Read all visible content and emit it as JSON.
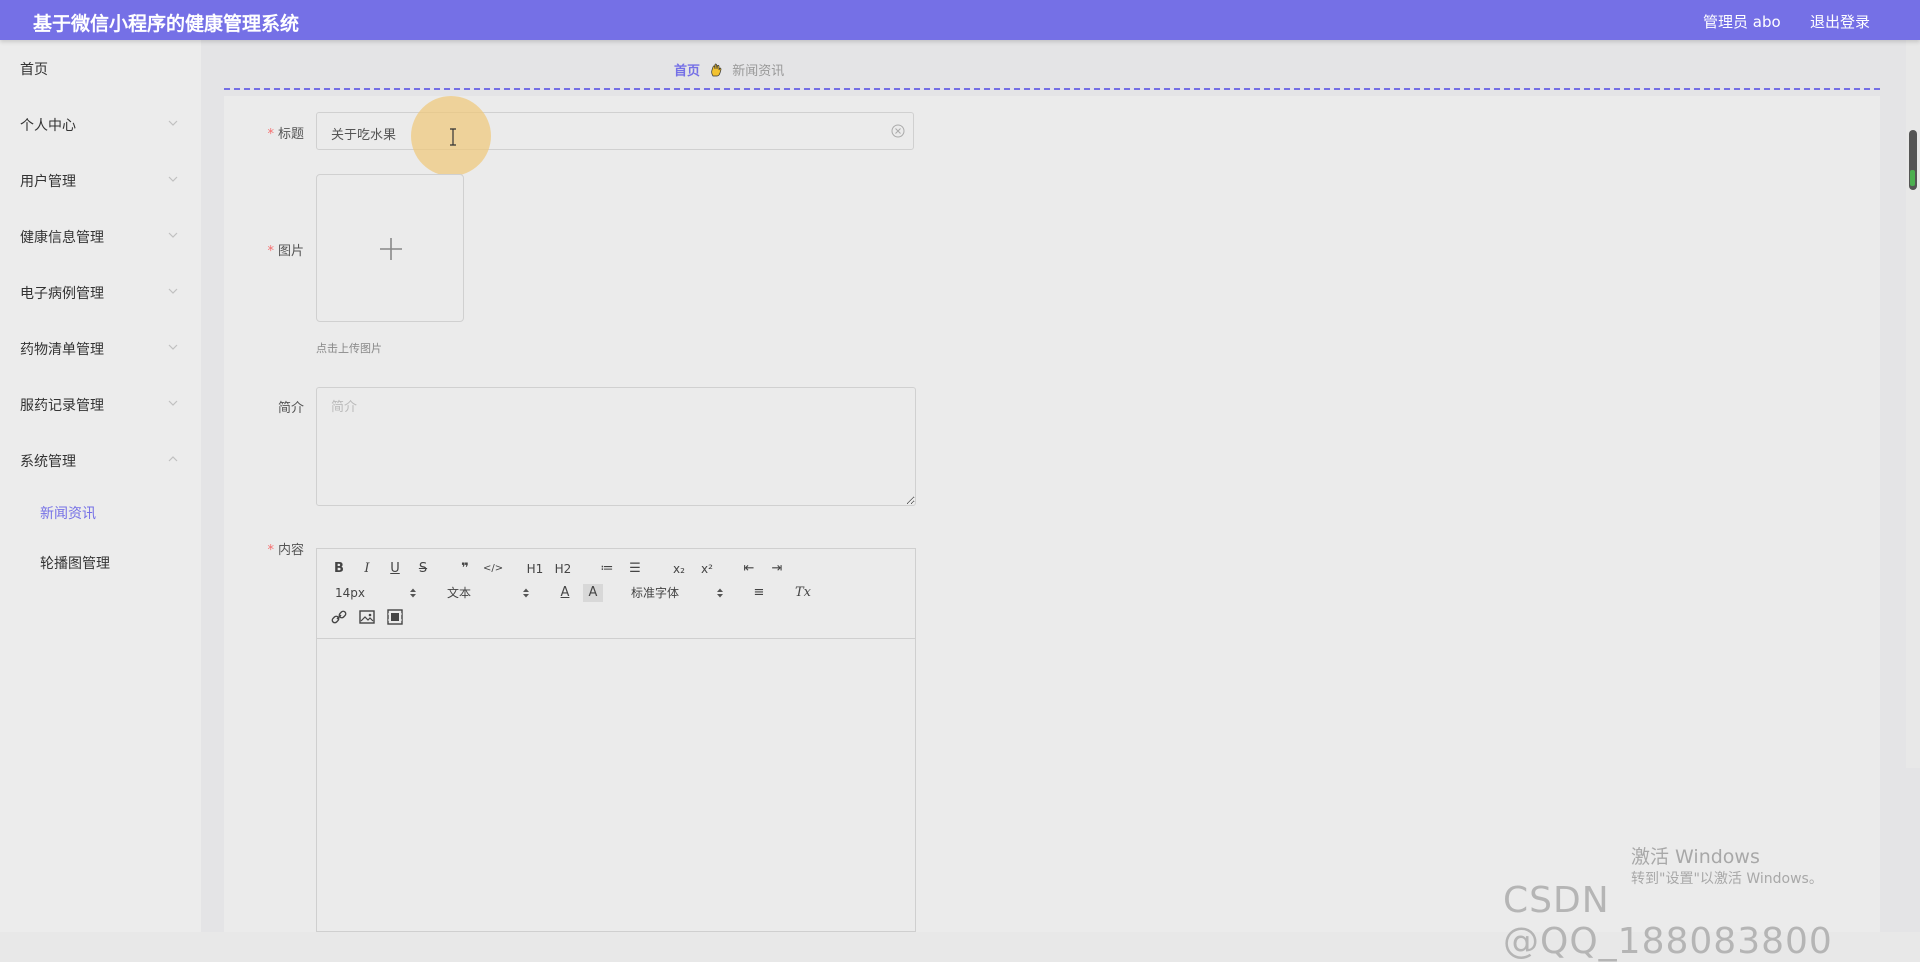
{
  "header": {
    "title": "基于微信小程序的健康管理系统",
    "admin_label": "管理员 abo",
    "logout": "退出登录",
    "color": "#7570e6"
  },
  "sidebar": {
    "items": [
      {
        "label": "首页"
      },
      {
        "label": "个人中心"
      },
      {
        "label": "用户管理"
      },
      {
        "label": "健康信息管理"
      },
      {
        "label": "电子病例管理"
      },
      {
        "label": "药物清单管理"
      },
      {
        "label": "服药记录管理"
      },
      {
        "label": "系统管理"
      }
    ],
    "sub_items": [
      {
        "label": "新闻资讯",
        "active": true
      },
      {
        "label": "轮播图管理",
        "active": false
      }
    ]
  },
  "breadcrumb": {
    "home": "首页",
    "current": "新闻资讯"
  },
  "form": {
    "title_label": "标题",
    "title_value": "关于吃水果",
    "image_label": "图片",
    "upload_hint": "点击上传图片",
    "summary_label": "简介",
    "summary_placeholder": "简介",
    "content_label": "内容",
    "required_mark": "*"
  },
  "editor": {
    "font_size": "14px",
    "header_select": "文本",
    "font_family": "标准字体",
    "buttons": {
      "bold": "B",
      "italic": "I",
      "underline": "U",
      "strike": "S",
      "quote": "❞",
      "code": "</>",
      "h1": "H1",
      "h2": "H2",
      "ordered_list": "≔",
      "bullet_list": "☰",
      "subscript": "x₂",
      "superscript": "x²",
      "outdent": "⇤",
      "indent": "⇥",
      "font_color": "A",
      "background": "A",
      "align": "≡",
      "clean": "Tx"
    }
  },
  "watermark": {
    "activate_title": "激活 Windows",
    "activate_sub": "转到\"设置\"以激活 Windows。",
    "csdn": "CSDN @QQ_188083800"
  }
}
